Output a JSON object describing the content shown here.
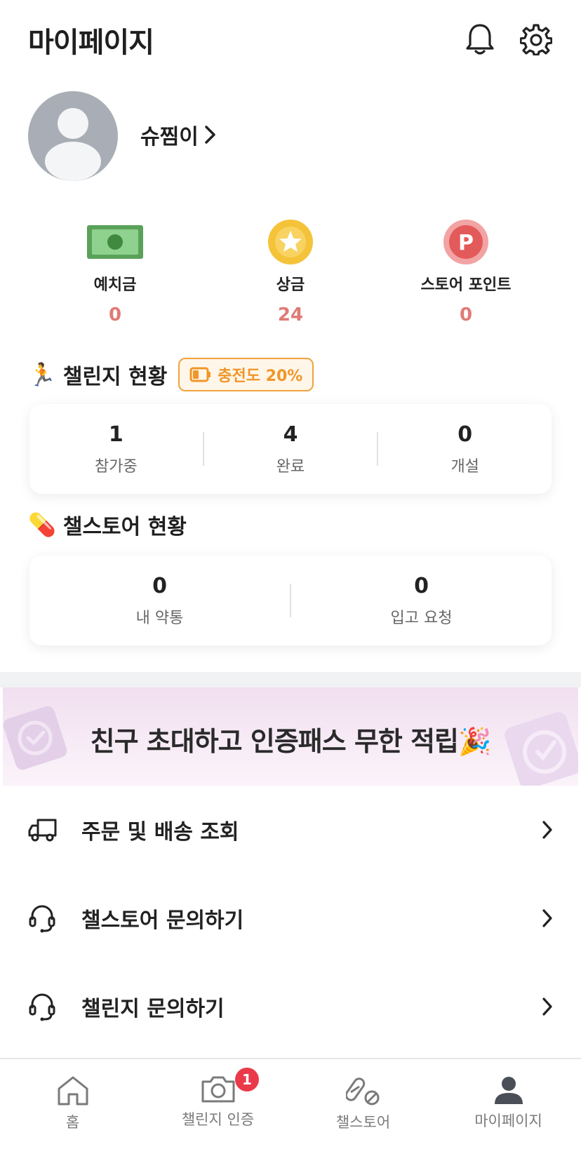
{
  "header": {
    "title": "마이페이지",
    "icons": [
      "bell-icon",
      "gear-icon"
    ]
  },
  "profile": {
    "name": "슈찜이"
  },
  "stats": [
    {
      "label": "예치금",
      "value": "0",
      "icon": "cash-icon"
    },
    {
      "label": "상금",
      "value": "24",
      "icon": "star-coin-icon"
    },
    {
      "label": "스토어 포인트",
      "value": "0",
      "icon": "point-coin-icon"
    }
  ],
  "challenge_status": {
    "title": "챌린지 현황",
    "emoji": "🏃",
    "charge_label": "충전도 20%",
    "items": [
      {
        "value": "1",
        "label": "참가중"
      },
      {
        "value": "4",
        "label": "완료"
      },
      {
        "value": "0",
        "label": "개설"
      }
    ]
  },
  "store_status": {
    "title": "챌스토어 현황",
    "emoji": "💊",
    "items": [
      {
        "value": "0",
        "label": "내 약통"
      },
      {
        "value": "0",
        "label": "입고 요청"
      }
    ]
  },
  "banner": {
    "text": "친구 초대하고 인증패스 무한 적립🎉"
  },
  "menu": [
    {
      "label": "주문 및 배송 조회",
      "icon": "truck-icon"
    },
    {
      "label": "챌스토어 문의하기",
      "icon": "headset-icon"
    },
    {
      "label": "챌린지 문의하기",
      "icon": "headset-icon"
    }
  ],
  "bottom_nav": [
    {
      "label": "홈",
      "icon": "home-icon"
    },
    {
      "label": "챌린지 인증",
      "icon": "camera-icon",
      "badge": "1"
    },
    {
      "label": "챌스토어",
      "icon": "pill-icon"
    },
    {
      "label": "마이페이지",
      "icon": "person-icon"
    }
  ],
  "colors": {
    "accent_value": "#e07a76",
    "charge": "#f09628",
    "badge": "#ea3a4a"
  }
}
